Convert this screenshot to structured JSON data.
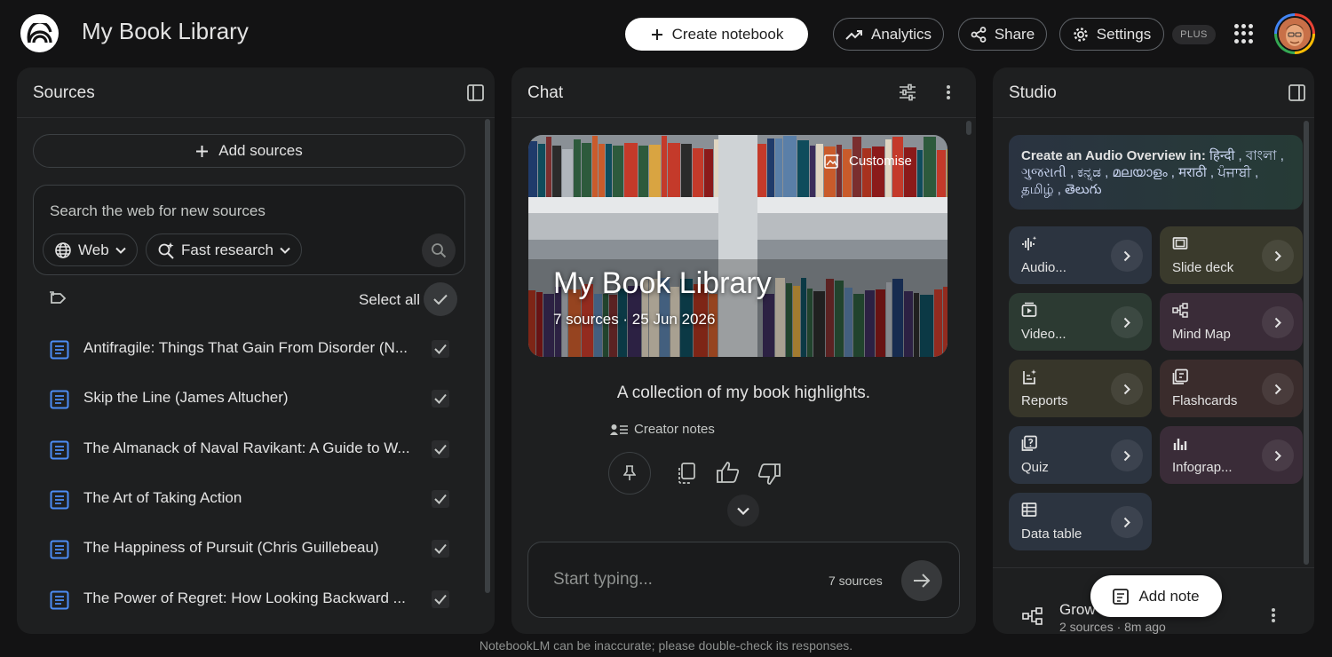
{
  "header": {
    "app_title": "My Book Library",
    "create_label": "Create notebook",
    "analytics_label": "Analytics",
    "share_label": "Share",
    "settings_label": "Settings",
    "plan_badge": "PLUS",
    "icons": [
      "notebooklm-logo-icon",
      "plus-icon",
      "trending-up-icon",
      "share-icon",
      "gear-icon",
      "apps-grid-icon",
      "avatar"
    ]
  },
  "sources": {
    "title": "Sources",
    "add_label": "Add sources",
    "search_placeholder": "Search the web for new sources",
    "web_chip": "Web",
    "research_chip": "Fast research",
    "select_all": "Select all",
    "items": [
      {
        "label": "Antifragile: Things That Gain From Disorder (N..."
      },
      {
        "label": "Skip the Line (James Altucher)"
      },
      {
        "label": "The Almanack of Naval Ravikant: A Guide to W..."
      },
      {
        "label": "The Art of Taking Action"
      },
      {
        "label": "The Happiness of Pursuit (Chris Guillebeau)"
      },
      {
        "label": "The Power of Regret: How Looking Backward ..."
      }
    ]
  },
  "chat": {
    "title": "Chat",
    "hero_title": "My Book Library",
    "hero_sub": "7 sources · 25 Jun 2026",
    "customise_label": "Customise",
    "summary": "A collection of my book highlights.",
    "creator_notes": "Creator notes",
    "input_placeholder": "Start typing...",
    "source_count": "7 sources"
  },
  "studio": {
    "title": "Studio",
    "audio_banner_prefix": "Create an Audio Overview in:",
    "audio_banner_languages": "हिन्दी , বাংলা , ગુજરાતી , ಕನ್ನಡ , മലയാളം , मराठी , ਪੰਜਾਬੀ , தமிழ் , తెలుగు",
    "tiles": [
      {
        "label": "Audio...",
        "icon": "audio-waveform-icon",
        "color": "#2c3440"
      },
      {
        "label": "Slide deck",
        "icon": "slides-icon",
        "color": "#3a3a2c"
      },
      {
        "label": "Video...",
        "icon": "video-icon",
        "color": "#2c3a32"
      },
      {
        "label": "Mind Map",
        "icon": "mind-map-icon",
        "color": "#3a2c38"
      },
      {
        "label": "Reports",
        "icon": "reports-icon",
        "color": "#37362a"
      },
      {
        "label": "Flashcards",
        "icon": "flashcards-icon",
        "color": "#3a2c2c"
      },
      {
        "label": "Quiz",
        "icon": "quiz-icon",
        "color": "#2c3440"
      },
      {
        "label": "Infograp...",
        "icon": "infographic-icon",
        "color": "#3a2c38"
      },
      {
        "label": "Data table",
        "icon": "data-table-icon",
        "color": "#2c3440"
      }
    ],
    "note": {
      "title": "Grow",
      "sub": "2 sources · 8m ago"
    },
    "add_note_label": "Add note"
  },
  "footer": {
    "disclaimer": "NotebookLM can be inaccurate; please double-check its responses."
  },
  "colors": {
    "background": "#131314",
    "panel": "#1e1f20",
    "accent_blue": "#4c8df6"
  }
}
